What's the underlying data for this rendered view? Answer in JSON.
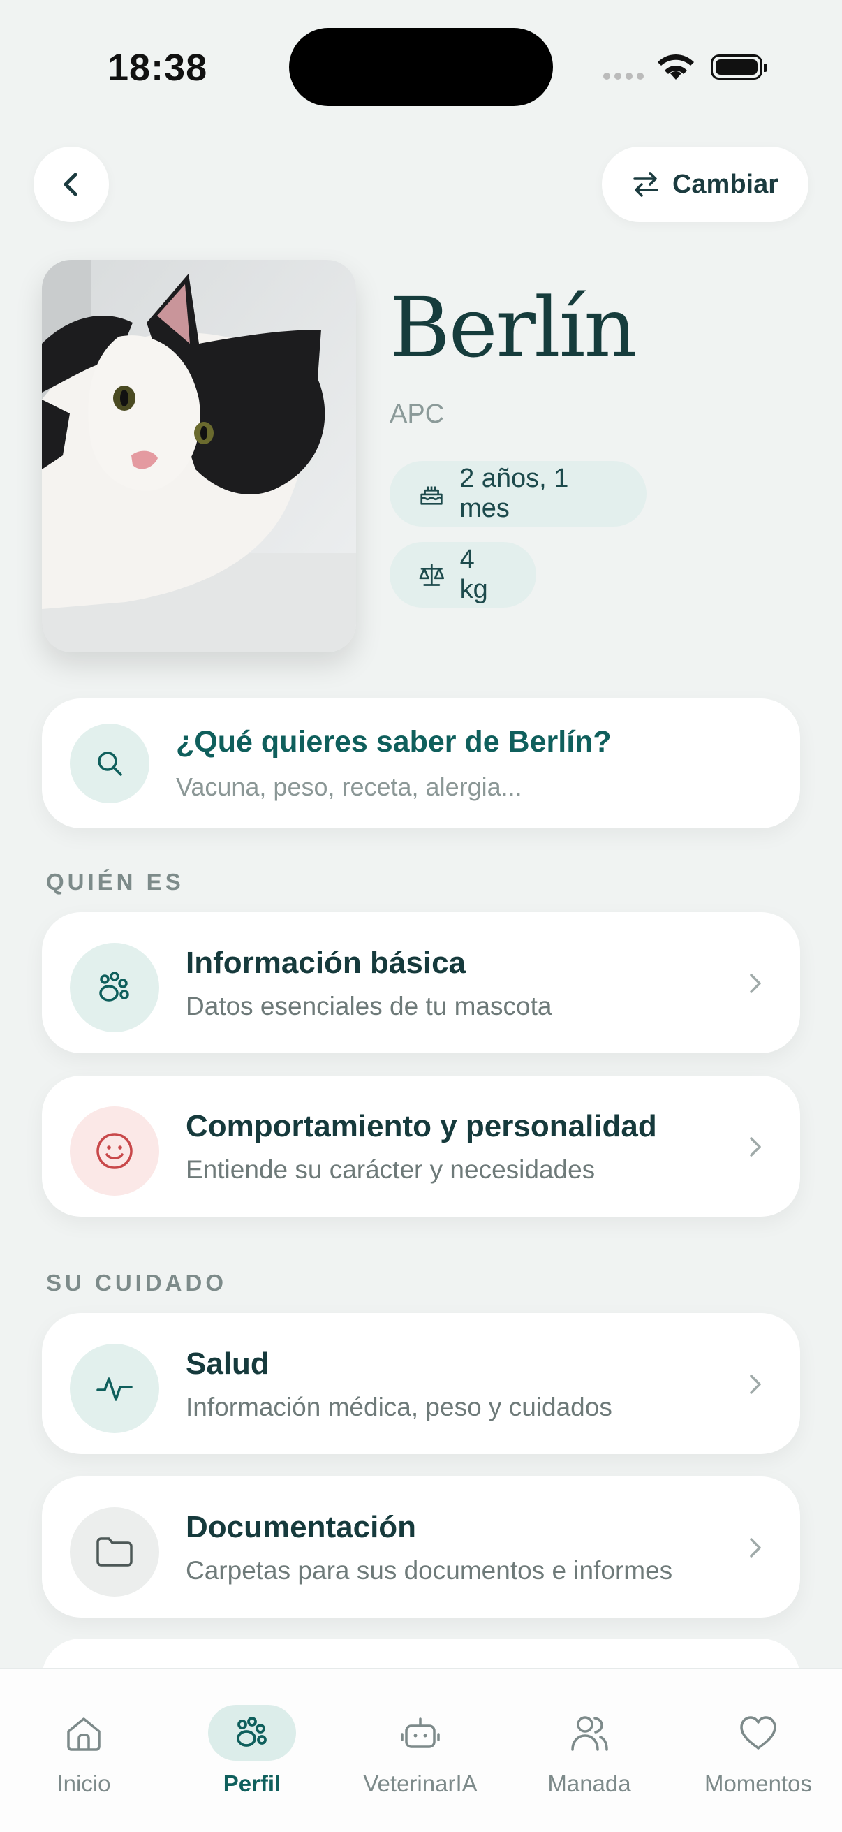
{
  "status_bar": {
    "time": "18:38"
  },
  "header": {
    "switch_label": "Cambiar"
  },
  "pet": {
    "name": "Berlín",
    "breed": "APC",
    "age": "2 años, 1 mes",
    "weight": "4 kg"
  },
  "search": {
    "title": "¿Qué quieres saber de Berlín?",
    "placeholder": "Vacuna, peso, receta, alergia..."
  },
  "sections": {
    "who": {
      "label": "QUIÉN ES",
      "items": [
        {
          "title": "Información básica",
          "subtitle": "Datos esenciales de tu mascota"
        },
        {
          "title": "Comportamiento y personalidad",
          "subtitle": "Entiende su carácter y necesidades"
        }
      ]
    },
    "care": {
      "label": "SU CUIDADO",
      "items": [
        {
          "title": "Salud",
          "subtitle": "Información médica, peso y cuidados"
        },
        {
          "title": "Documentación",
          "subtitle": "Carpetas para sus documentos e informes"
        }
      ]
    }
  },
  "tabbar": {
    "items": [
      {
        "label": "Inicio",
        "icon": "home-icon"
      },
      {
        "label": "Perfil",
        "icon": "paw-icon",
        "active": true
      },
      {
        "label": "VeterinarIA",
        "icon": "robot-icon"
      },
      {
        "label": "Manada",
        "icon": "users-icon"
      },
      {
        "label": "Momentos",
        "icon": "heart-icon"
      }
    ]
  },
  "colors": {
    "accent": "#0f5f5c",
    "background": "#f0f3f2",
    "chip": "#e3efed"
  }
}
